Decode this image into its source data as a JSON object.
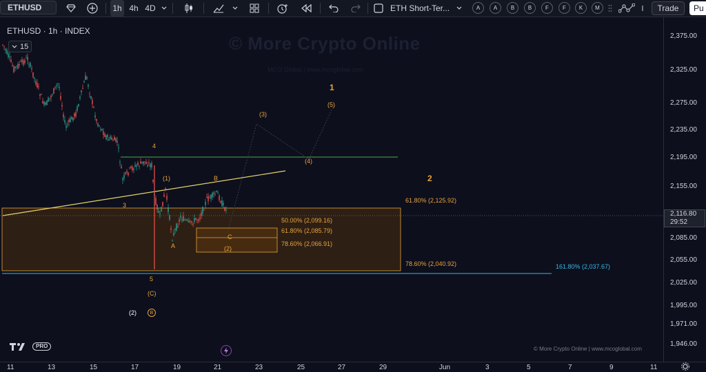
{
  "toolbar": {
    "symbol": "ETHUSD",
    "timeframes": [
      "1h",
      "4h",
      "4D"
    ],
    "active_timeframe": "1h",
    "layout_name": "ETH Short-Ter...",
    "letters": [
      "A",
      "A",
      "B",
      "B",
      "F",
      "F",
      "K",
      "M"
    ],
    "trade_label": "Trade",
    "publish_label": "Pu"
  },
  "chart": {
    "title": "ETHUSD · 1h · INDEX",
    "volume_label": "15",
    "watermark_title": "© More Crypto Online",
    "watermark_sub": "MCO Global   |   www.mcoglobal.com",
    "copyright": "© More Crypto Online  |  www.mcoglobal.com",
    "tv_pro_label": "PRO",
    "current_price": "2,116.80",
    "countdown": "29:52",
    "colors": {
      "background": "#0d0f1c",
      "up": "#26a69a",
      "down": "#ef5350",
      "fib": "#e8a33d",
      "wave": "#e8a33d",
      "green_line": "#4caf50",
      "trend_line": "#e6d56b",
      "extension": "#3ab6e8"
    }
  },
  "waves": {
    "w1": "1",
    "w2": "2",
    "w3": "3",
    "w4": "4",
    "w5": "5",
    "p1": "(1)",
    "p2": "(2)",
    "p3": "(3)",
    "p4": "(4)",
    "p5": "(5)",
    "a": "A",
    "b": "B",
    "c": "C",
    "pc": "(C)",
    "p2b": "(2)",
    "circle_b": "B"
  },
  "fibs": {
    "f61_upper": "61.80% (2,125.92)",
    "f50": "50.00% (2,099.16)",
    "f61": "61.80% (2,085.79)",
    "f78": "78.60% (2,066.91)",
    "f78_lower": "78.60% (2,040.92)",
    "ext161": "161.80% (2,037.67)"
  },
  "chart_data": {
    "type": "candlestick",
    "symbol": "ETHUSD",
    "timeframe": "1h",
    "y_ticks": [
      "2,375.00",
      "2,325.00",
      "2,275.00",
      "2,235.00",
      "2,195.00",
      "2,155.00",
      "2,085.00",
      "2,055.00",
      "2,025.00",
      "1,995.00",
      "1,971.00",
      "1,946.00"
    ],
    "x_ticks": [
      "11",
      "13",
      "15",
      "17",
      "19",
      "21",
      "23",
      "25",
      "27",
      "29",
      "Jun",
      "3",
      "5",
      "7",
      "9",
      "11"
    ],
    "current_price": 2116.8
  }
}
